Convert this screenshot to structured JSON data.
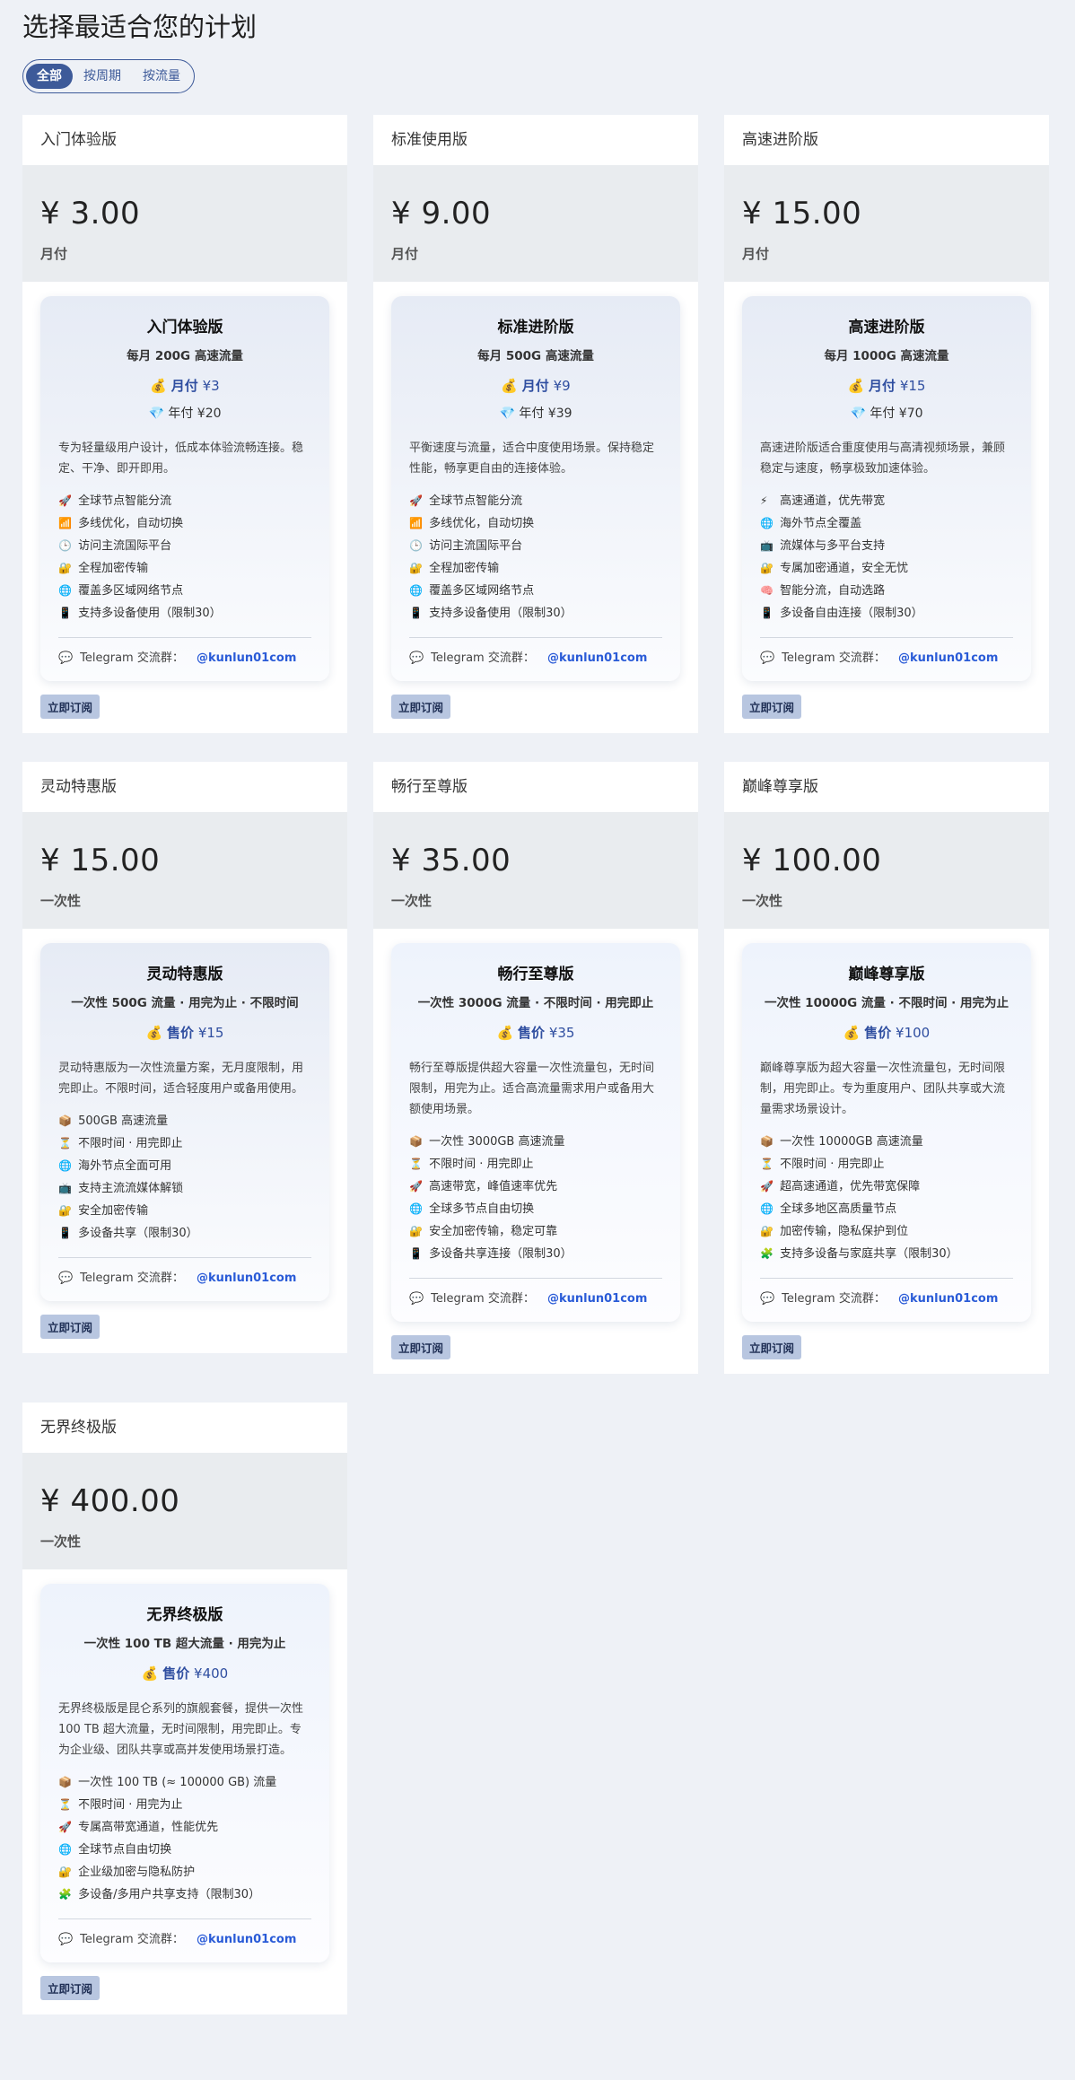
{
  "page": {
    "title": "选择最适合您的计划"
  },
  "tabs": [
    {
      "label": "全部",
      "active": true
    },
    {
      "label": "按周期",
      "active": false
    },
    {
      "label": "按流量",
      "active": false
    }
  ],
  "common": {
    "subscribe_label": "立即订阅",
    "telegram_label": "Telegram 交流群：",
    "telegram_handle": "@kunlun01com"
  },
  "plans": [
    {
      "name": "入门体验版",
      "price": "¥ 3.00",
      "period": "月付",
      "card_title": "入门体验版",
      "card_sub": "每月 200G 高速流量",
      "price1_label": "月付",
      "price1_value": "¥3",
      "price2_label": "年付",
      "price2_value": "¥20",
      "desc": "专为轻量级用户设计，低成本体验流畅连接。稳定、干净、即开即用。",
      "features": [
        {
          "icon": "🚀",
          "text": "全球节点智能分流"
        },
        {
          "icon": "📶",
          "text": "多线优化，自动切换"
        },
        {
          "icon": "🕒",
          "text": "访问主流国际平台"
        },
        {
          "icon": "🔐",
          "text": "全程加密传输"
        },
        {
          "icon": "🌐",
          "text": "覆盖多区域网络节点"
        },
        {
          "icon": "📱",
          "text": "支持多设备使用（限制30）"
        }
      ]
    },
    {
      "name": "标准使用版",
      "price": "¥ 9.00",
      "period": "月付",
      "card_title": "标准进阶版",
      "card_sub": "每月 500G 高速流量",
      "price1_label": "月付",
      "price1_value": "¥9",
      "price2_label": "年付",
      "price2_value": "¥39",
      "desc": "平衡速度与流量，适合中度使用场景。保持稳定性能，畅享更自由的连接体验。",
      "features": [
        {
          "icon": "🚀",
          "text": "全球节点智能分流"
        },
        {
          "icon": "📶",
          "text": "多线优化，自动切换"
        },
        {
          "icon": "🕒",
          "text": "访问主流国际平台"
        },
        {
          "icon": "🔐",
          "text": "全程加密传输"
        },
        {
          "icon": "🌐",
          "text": "覆盖多区域网络节点"
        },
        {
          "icon": "📱",
          "text": "支持多设备使用（限制30）"
        }
      ]
    },
    {
      "name": "高速进阶版",
      "price": "¥ 15.00",
      "period": "月付",
      "card_title": "高速进阶版",
      "card_sub": "每月 1000G 高速流量",
      "price1_label": "月付",
      "price1_value": "¥15",
      "price2_label": "年付",
      "price2_value": "¥70",
      "desc": "高速进阶版适合重度使用与高清视频场景，兼顾稳定与速度，畅享极致加速体验。",
      "features": [
        {
          "icon": "⚡",
          "text": "高速通道，优先带宽"
        },
        {
          "icon": "🌐",
          "text": "海外节点全覆盖"
        },
        {
          "icon": "📺",
          "text": "流媒体与多平台支持"
        },
        {
          "icon": "🔐",
          "text": "专属加密通道，安全无忧"
        },
        {
          "icon": "🧠",
          "text": "智能分流，自动选路"
        },
        {
          "icon": "📱",
          "text": "多设备自由连接（限制30）"
        }
      ]
    },
    {
      "name": "灵动特惠版",
      "price": "¥ 15.00",
      "period": "一次性",
      "card_title": "灵动特惠版",
      "card_sub": "一次性 500G 流量 · 用完为止 · 不限时间",
      "price1_label": "售价",
      "price1_value": "¥15",
      "price2_label": "",
      "price2_value": "",
      "desc": "灵动特惠版为一次性流量方案，无月度限制，用完即止。不限时间，适合轻度用户或备用使用。",
      "features": [
        {
          "icon": "📦",
          "text": "500GB 高速流量"
        },
        {
          "icon": "⏳",
          "text": "不限时间 · 用完即止"
        },
        {
          "icon": "🌐",
          "text": "海外节点全面可用"
        },
        {
          "icon": "📺",
          "text": "支持主流流媒体解锁"
        },
        {
          "icon": "🔐",
          "text": "安全加密传输"
        },
        {
          "icon": "📱",
          "text": "多设备共享（限制30）"
        }
      ]
    },
    {
      "name": "畅行至尊版",
      "price": "¥ 35.00",
      "period": "一次性",
      "card_title": "畅行至尊版",
      "card_sub": "一次性 3000G 流量 · 不限时间 · 用完即止",
      "price1_label": "售价",
      "price1_value": "¥35",
      "price2_label": "",
      "price2_value": "",
      "desc": "畅行至尊版提供超大容量一次性流量包，无时间限制，用完为止。适合高流量需求用户或备用大额使用场景。",
      "features": [
        {
          "icon": "📦",
          "text": "一次性 3000GB 高速流量"
        },
        {
          "icon": "⏳",
          "text": "不限时间 · 用完即止"
        },
        {
          "icon": "🚀",
          "text": "高速带宽，峰值速率优先"
        },
        {
          "icon": "🌐",
          "text": "全球多节点自由切换"
        },
        {
          "icon": "🔐",
          "text": "安全加密传输，稳定可靠"
        },
        {
          "icon": "📱",
          "text": "多设备共享连接（限制30）"
        }
      ]
    },
    {
      "name": "巅峰尊享版",
      "price": "¥ 100.00",
      "period": "一次性",
      "card_title": "巅峰尊享版",
      "card_sub": "一次性 10000G 流量 · 不限时间 · 用完为止",
      "price1_label": "售价",
      "price1_value": "¥100",
      "price2_label": "",
      "price2_value": "",
      "desc": "巅峰尊享版为超大容量一次性流量包，无时间限制，用完即止。专为重度用户、团队共享或大流量需求场景设计。",
      "features": [
        {
          "icon": "📦",
          "text": "一次性 10000GB 高速流量"
        },
        {
          "icon": "⏳",
          "text": "不限时间 · 用完即止"
        },
        {
          "icon": "🚀",
          "text": "超高速通道，优先带宽保障"
        },
        {
          "icon": "🌐",
          "text": "全球多地区高质量节点"
        },
        {
          "icon": "🔐",
          "text": "加密传输，隐私保护到位"
        },
        {
          "icon": "🧩",
          "text": "支持多设备与家庭共享（限制30）"
        }
      ]
    },
    {
      "name": "无界终极版",
      "price": "¥ 400.00",
      "period": "一次性",
      "card_title": "无界终极版",
      "card_sub": "一次性 100 TB 超大流量 · 用完为止",
      "price1_label": "售价",
      "price1_value": "¥400",
      "price2_label": "",
      "price2_value": "",
      "desc": "无界终极版是昆仑系列的旗舰套餐，提供一次性 100 TB 超大流量，无时间限制，用完即止。专为企业级、团队共享或高并发使用场景打造。",
      "features": [
        {
          "icon": "📦",
          "text": "一次性 100 TB (≈ 100000 GB) 流量"
        },
        {
          "icon": "⏳",
          "text": "不限时间 · 用完为止"
        },
        {
          "icon": "🚀",
          "text": "专属高带宽通道，性能优先"
        },
        {
          "icon": "🌐",
          "text": "全球节点自由切换"
        },
        {
          "icon": "🔐",
          "text": "企业级加密与隐私防护"
        },
        {
          "icon": "🧩",
          "text": "多设备/多用户共享支持（限制30）"
        }
      ]
    }
  ]
}
